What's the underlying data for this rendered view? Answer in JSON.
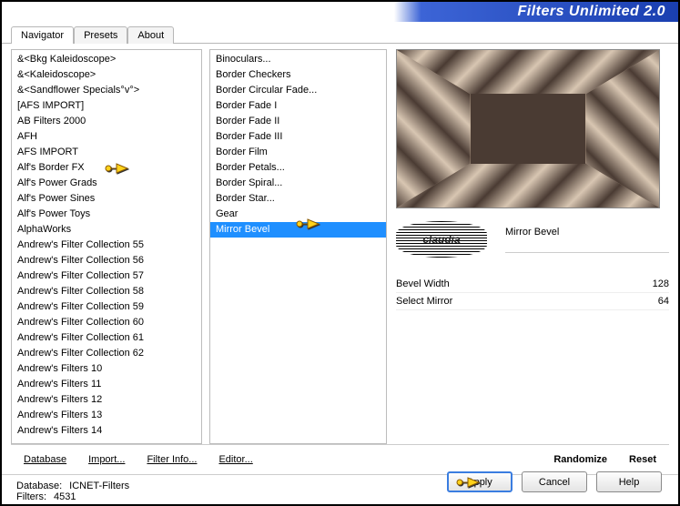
{
  "title": "Filters Unlimited 2.0",
  "tabs": [
    "Navigator",
    "Presets",
    "About"
  ],
  "active_tab": 0,
  "left_list": [
    "&<Bkg Kaleidoscope>",
    "&<Kaleidoscope>",
    "&<Sandflower Specials°v°>",
    "[AFS IMPORT]",
    "AB Filters 2000",
    "AFH",
    "AFS IMPORT",
    "Alf's Border FX",
    "Alf's Power Grads",
    "Alf's Power Sines",
    "Alf's Power Toys",
    "AlphaWorks",
    "Andrew's Filter Collection 55",
    "Andrew's Filter Collection 56",
    "Andrew's Filter Collection 57",
    "Andrew's Filter Collection 58",
    "Andrew's Filter Collection 59",
    "Andrew's Filter Collection 60",
    "Andrew's Filter Collection 61",
    "Andrew's Filter Collection 62",
    "Andrew's Filters 10",
    "Andrew's Filters 11",
    "Andrew's Filters 12",
    "Andrew's Filters 13",
    "Andrew's Filters 14"
  ],
  "mid_list": [
    "Binoculars...",
    "Border Checkers",
    "Border Circular Fade...",
    "Border Fade I",
    "Border Fade II",
    "Border Fade III",
    "Border Film",
    "Border Petals...",
    "Border Spiral...",
    "Border Star...",
    "Gear",
    "Mirror Bevel"
  ],
  "mid_selected": 11,
  "filter_name": "Mirror Bevel",
  "logo_text": "claudia",
  "params": [
    {
      "label": "Bevel Width",
      "value": 128
    },
    {
      "label": "Select Mirror",
      "value": 64
    }
  ],
  "toolbar": {
    "database": "Database",
    "import": "Import...",
    "filter_info": "Filter Info...",
    "editor": "Editor...",
    "randomize": "Randomize",
    "reset": "Reset"
  },
  "status": {
    "db_label": "Database:",
    "db_value": "ICNET-Filters",
    "filters_label": "Filters:",
    "filters_value": "4531"
  },
  "buttons": {
    "apply": "Apply",
    "cancel": "Cancel",
    "help": "Help"
  }
}
